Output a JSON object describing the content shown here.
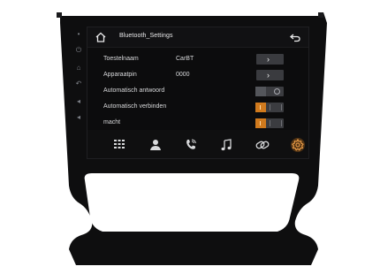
{
  "header": {
    "title": "Bluetooth_Settings"
  },
  "rows": [
    {
      "label": "Toestelnaam",
      "value": "CarBT",
      "control": "arrow"
    },
    {
      "label": "Apparaatpin",
      "value": "0000",
      "control": "arrow"
    },
    {
      "label": "Automatisch antwoord",
      "value": "",
      "control": "toggle",
      "state": "off"
    },
    {
      "label": "Automatisch verbinden",
      "value": "",
      "control": "toggle",
      "state": "on"
    },
    {
      "label": "macht",
      "value": "",
      "control": "toggle",
      "state": "on"
    }
  ],
  "bottom_bar": [
    {
      "icon": "keypad-icon"
    },
    {
      "icon": "contacts-icon"
    },
    {
      "icon": "call-log-icon"
    },
    {
      "icon": "music-icon"
    },
    {
      "icon": "link-icon"
    },
    {
      "icon": "settings-icon",
      "active": true
    }
  ],
  "colors": {
    "accent": "#d07a1d",
    "screen_bg": "#0c0c0d",
    "bezel": "#0e0e0f"
  }
}
